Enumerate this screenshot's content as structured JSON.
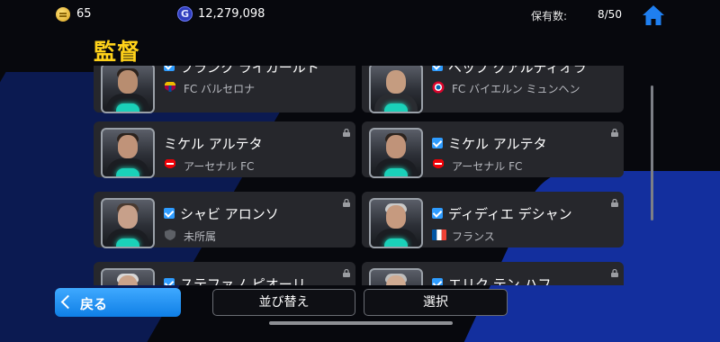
{
  "header": {
    "coins": "65",
    "gp": "12,279,098",
    "gp_icon_letter": "G",
    "owned_label": "保有数:",
    "owned_value": "8/50",
    "home_icon": "home-icon",
    "coin_icon": "coin-icon"
  },
  "title": "監督",
  "managers": [
    {
      "name": "フランク ライカールト",
      "club": "FC バルセロナ",
      "checked": true,
      "club_icon": "barcelona-crest-icon"
    },
    {
      "name": "ペップ グアルディオラ",
      "club": "FC バイエルン ミュンヘン",
      "checked": true,
      "club_icon": "bayern-crest-icon"
    },
    {
      "name": "ミケル アルテタ",
      "club": "アーセナル FC",
      "checked": false,
      "club_icon": "arsenal-crest-icon"
    },
    {
      "name": "ミケル アルテタ",
      "club": "アーセナル FC",
      "checked": true,
      "club_icon": "arsenal-crest-icon"
    },
    {
      "name": "シャビ アロンソ",
      "club": "未所属",
      "checked": true,
      "club_icon": "unaffiliated-shield-icon"
    },
    {
      "name": "ディディエ デシャン",
      "club": "フランス",
      "checked": true,
      "club_icon": "france-flag-icon"
    },
    {
      "name": "ステファノ ピオーリ",
      "club": "",
      "checked": true,
      "club_icon": ""
    },
    {
      "name": "エリク テン ハフ",
      "club": "",
      "checked": true,
      "club_icon": ""
    }
  ],
  "footer": {
    "back": "戻る",
    "sort": "並び替え",
    "select": "選択"
  },
  "colors": {
    "accent_blue": "#2e9cff",
    "title_yellow": "#ffd21a",
    "card_bg": "#26272c",
    "badge_teal": "#1ad1b9"
  }
}
